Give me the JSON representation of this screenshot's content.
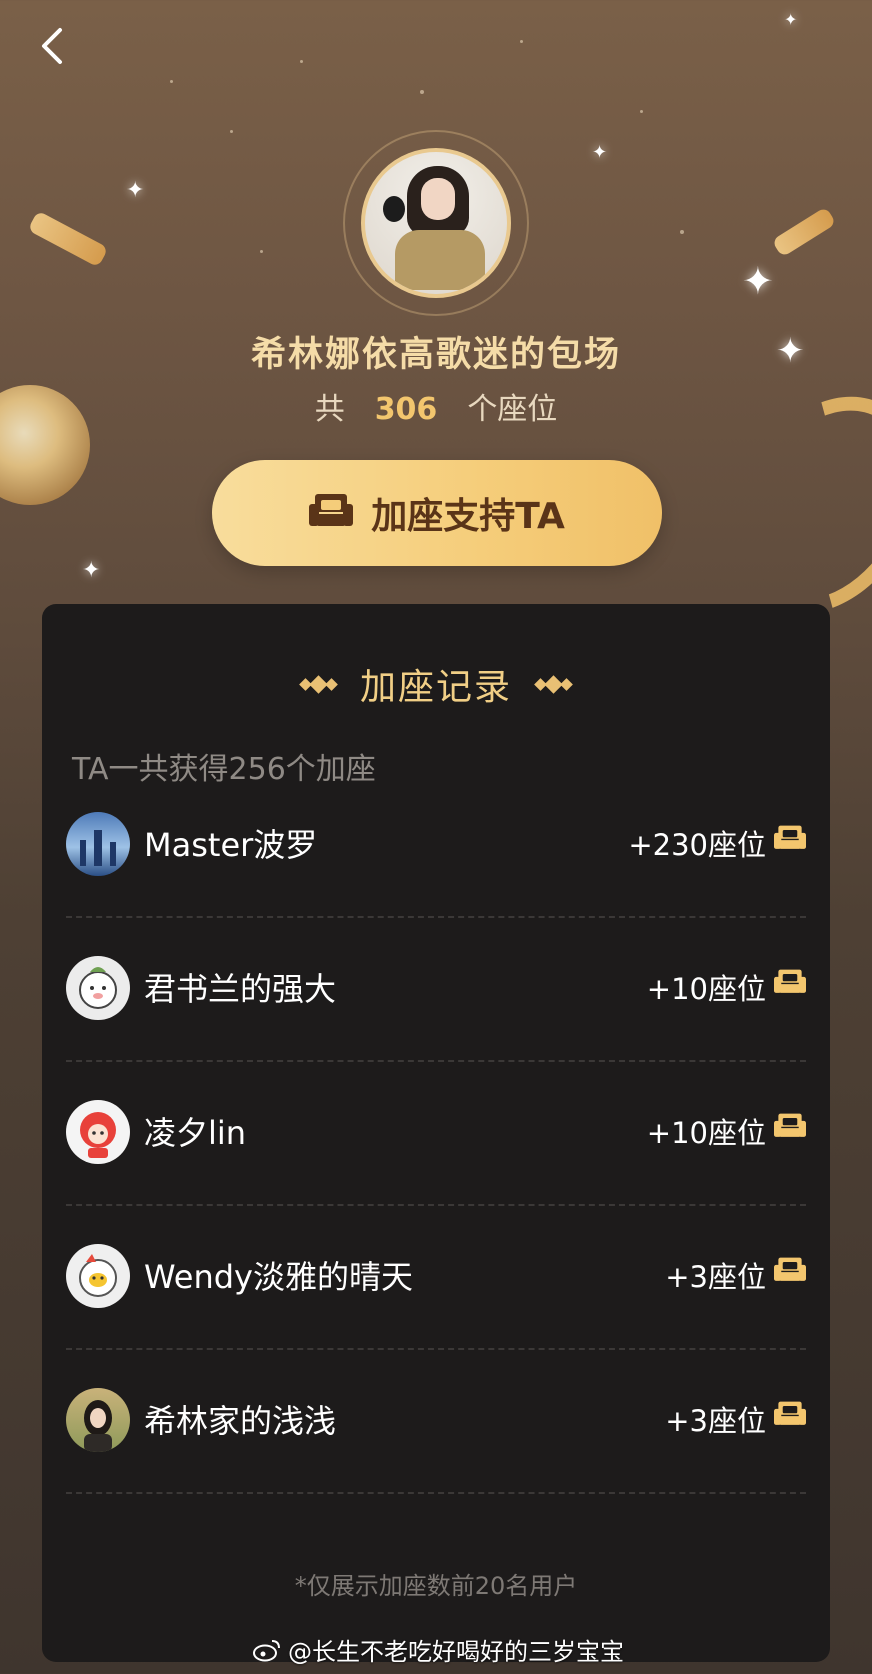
{
  "header": {
    "back_icon": "chevron-left-icon",
    "title": "希林娜依高歌迷的包场",
    "seats_prefix": "共",
    "seats_count": "306",
    "seats_suffix": "个座位"
  },
  "support_button": {
    "label": "加座支持TA",
    "icon": "sofa-icon"
  },
  "records": {
    "title": "加座记录",
    "total_text": "TA一共获得256个加座",
    "items": [
      {
        "name": "Master波罗",
        "amount": "+230座位"
      },
      {
        "name": "君书兰的强大",
        "amount": "+10座位"
      },
      {
        "name": "凌夕lin",
        "amount": "+10座位"
      },
      {
        "name": "Wendy淡雅的晴天",
        "amount": "+3座位"
      },
      {
        "name": "希林家的浅浅",
        "amount": "+3座位"
      }
    ],
    "footnote": "*仅展示加座数前20名用户"
  },
  "watermark": {
    "icon": "weibo-icon",
    "text": "@长生不老吃好喝好的三岁宝宝"
  },
  "colors": {
    "accent_gold": "#f3c66e",
    "button_gold": "#f5cd7a",
    "panel_bg": "#1d1b1b"
  }
}
